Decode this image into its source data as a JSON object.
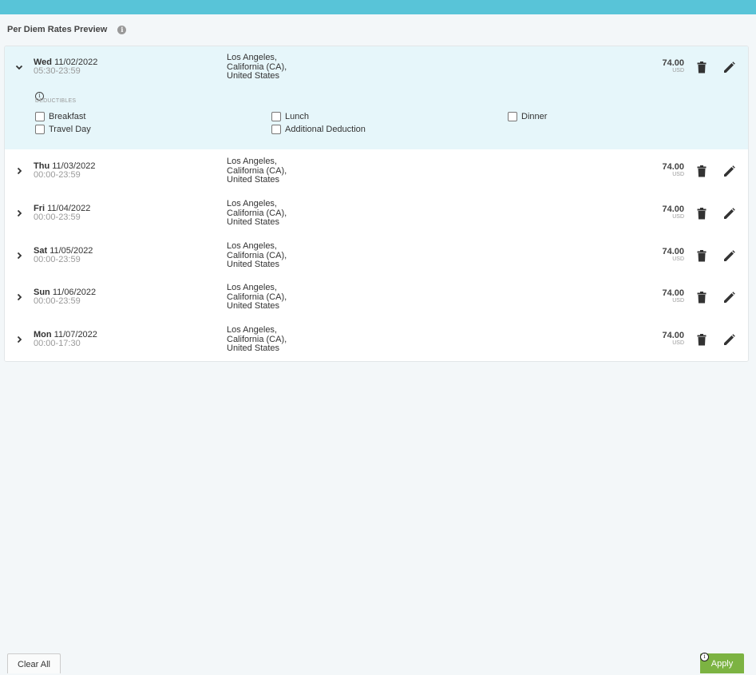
{
  "header": {
    "title": "Per Diem Rates Preview",
    "info_icon": "info-circle-icon"
  },
  "rows": [
    {
      "day": "Wed",
      "date": "11/02/2022",
      "time": "05:30-23:59",
      "loc1": "Los Angeles,",
      "loc2": "California (CA),",
      "loc3": "United States",
      "amount": "74.00",
      "currency": "USD",
      "expanded": true
    },
    {
      "day": "Thu",
      "date": "11/03/2022",
      "time": "00:00-23:59",
      "loc1": "Los Angeles,",
      "loc2": "California (CA),",
      "loc3": "United States",
      "amount": "74.00",
      "currency": "USD",
      "expanded": false
    },
    {
      "day": "Fri",
      "date": "11/04/2022",
      "time": "00:00-23:59",
      "loc1": "Los Angeles,",
      "loc2": "California (CA),",
      "loc3": "United States",
      "amount": "74.00",
      "currency": "USD",
      "expanded": false
    },
    {
      "day": "Sat",
      "date": "11/05/2022",
      "time": "00:00-23:59",
      "loc1": "Los Angeles,",
      "loc2": "California (CA),",
      "loc3": "United States",
      "amount": "74.00",
      "currency": "USD",
      "expanded": false
    },
    {
      "day": "Sun",
      "date": "11/06/2022",
      "time": "00:00-23:59",
      "loc1": "Los Angeles,",
      "loc2": "California (CA),",
      "loc3": "United States",
      "amount": "74.00",
      "currency": "USD",
      "expanded": false
    },
    {
      "day": "Mon",
      "date": "11/07/2022",
      "time": "00:00-17:30",
      "loc1": "Los Angeles,",
      "loc2": "California (CA),",
      "loc3": "United States",
      "amount": "74.00",
      "currency": "USD",
      "expanded": false
    }
  ],
  "deductibles": {
    "label": "DEDUCTIBLES",
    "options": [
      {
        "label": "Breakfast",
        "checked": false
      },
      {
        "label": "Lunch",
        "checked": false
      },
      {
        "label": "Dinner",
        "checked": false
      },
      {
        "label": "Travel Day",
        "checked": false
      },
      {
        "label": "Additional Deduction",
        "checked": false
      }
    ]
  },
  "footer": {
    "clear_label": "Clear All",
    "apply_label": "Apply"
  },
  "colors": {
    "top_bar": "#58c4d8",
    "expanded_row": "#e6f6fa",
    "apply_button": "#7cb342"
  }
}
